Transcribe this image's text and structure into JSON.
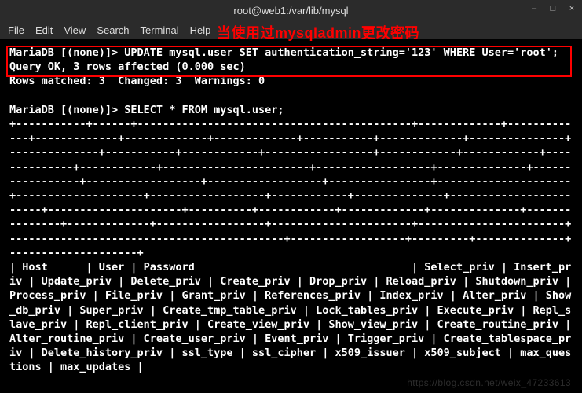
{
  "titlebar": {
    "title": "root@web1:/var/lib/mysql"
  },
  "menubar": {
    "file": "File",
    "edit": "Edit",
    "view": "View",
    "search": "Search",
    "terminal": "Terminal",
    "help": "Help",
    "annotation": "当使用过mysqladmin更改密码"
  },
  "term": {
    "l1": "MariaDB [(none)]> UPDATE mysql.user SET authentication_string='123' WHERE User='root';",
    "l2": "Query OK, 3 rows affected (0.000 sec)",
    "l3": "Rows matched: 3  Changed: 3  Warnings: 0",
    "l4": "",
    "l5": "MariaDB [(none)]> SELECT * FROM mysql.user;",
    "l6": "+-----------+------+-------------------------------------------+-------------+-------------+-------------+-------------+-------------+-----------+-------------+---------------+--------------+-----------+------------+-----------------+------------+------------+--------------+------------+-----------------------+------------------+--------------+-----------------+------------------+------------------+----------------+---------------------+--------------------+------------------+------------+--------------+------------------------+---------------------+----------+------------+-------------+--------------+---------------+-------------+-----------------+----------------------+-----------------------+-------------------------------------------+------------------+---------+--------------+--------------------+",
    "l7": "| Host      | User | Password                                  | Select_priv | Insert_priv | Update_priv | Delete_priv | Create_priv | Drop_priv | Reload_priv | Shutdown_priv | Process_priv | File_priv | Grant_priv | References_priv | Index_priv | Alter_priv | Show_db_priv | Super_priv | Create_tmp_table_priv | Lock_tables_priv | Execute_priv | Repl_slave_priv | Repl_client_priv | Create_view_priv | Show_view_priv | Create_routine_priv | Alter_routine_priv | Create_user_priv | Event_priv | Trigger_priv | Create_tablespace_priv | Delete_history_priv | ssl_type | ssl_cipher | x509_issuer | x509_subject | max_questions | max_updates |"
  },
  "watermark": "https://blog.csdn.net/weix_47233613"
}
